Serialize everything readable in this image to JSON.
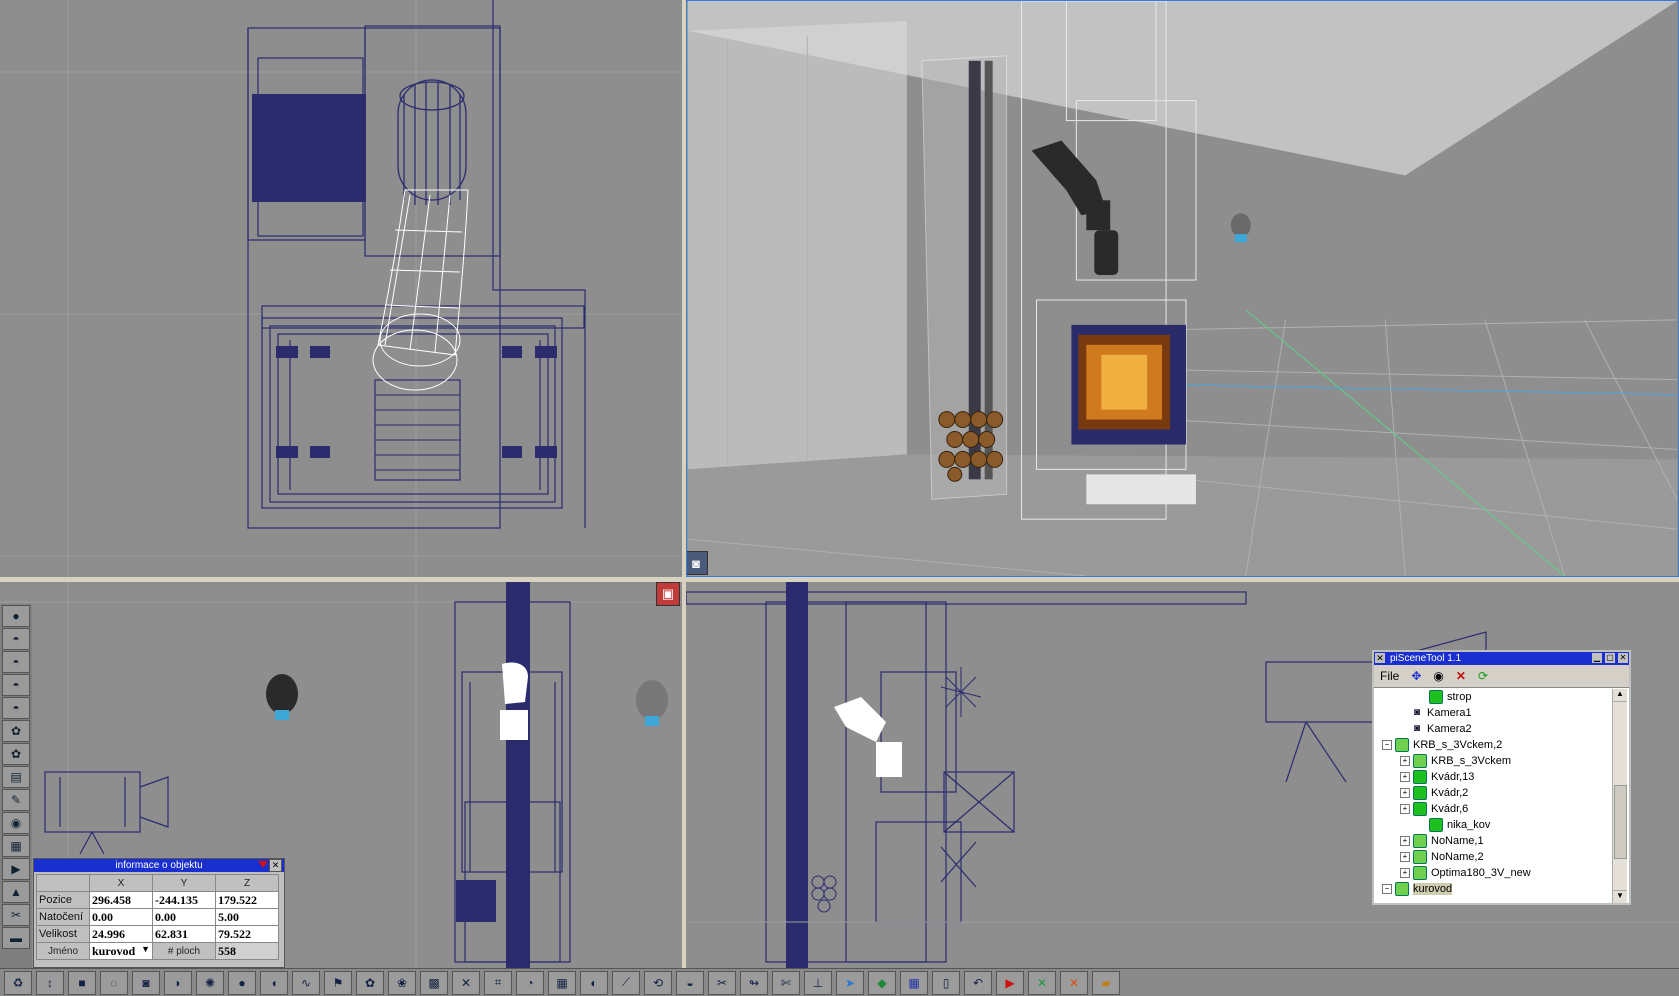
{
  "info_panel": {
    "title": "informace o objektu",
    "col_x": "X",
    "col_y": "Y",
    "col_z": "Z",
    "rows": [
      {
        "label": "Pozice",
        "x": "296.458",
        "y": "-244.135",
        "z": "179.522"
      },
      {
        "label": "Natočení",
        "x": "0.00",
        "y": "0.00",
        "z": "5.00"
      },
      {
        "label": "Velikost",
        "x": "24.996",
        "y": "62.831",
        "z": "79.522"
      }
    ],
    "name_label": "Jméno",
    "name_value": "kurovod",
    "faces_label": "# ploch",
    "faces_value": "558"
  },
  "scene_tool": {
    "title": "piSceneTool 1.1",
    "menu_file": "File",
    "nodes": [
      {
        "label": "strop",
        "depth": 2,
        "expander": "",
        "icon": "object-icon"
      },
      {
        "label": "Kamera1",
        "depth": 1,
        "expander": "",
        "icon": "camera-icon"
      },
      {
        "label": "Kamera2",
        "depth": 1,
        "expander": "",
        "icon": "camera-icon"
      },
      {
        "label": "KRB_s_3Vckem,2",
        "depth": 0,
        "expander": "−",
        "icon": "group-icon"
      },
      {
        "label": "KRB_s_3Vckem",
        "depth": 1,
        "expander": "+",
        "icon": "group-icon"
      },
      {
        "label": "Kvádr,13",
        "depth": 1,
        "expander": "+",
        "icon": "object-icon"
      },
      {
        "label": "Kvádr,2",
        "depth": 1,
        "expander": "+",
        "icon": "object-icon"
      },
      {
        "label": "Kvádr,6",
        "depth": 1,
        "expander": "+",
        "icon": "object-icon"
      },
      {
        "label": "nika_kov",
        "depth": 2,
        "expander": "",
        "icon": "object-icon"
      },
      {
        "label": "NoName,1",
        "depth": 1,
        "expander": "+",
        "icon": "group-icon"
      },
      {
        "label": "NoName,2",
        "depth": 1,
        "expander": "+",
        "icon": "group-icon"
      },
      {
        "label": "Optima180_3V_new",
        "depth": 1,
        "expander": "+",
        "icon": "group-icon"
      },
      {
        "label": "kurovod",
        "depth": 0,
        "expander": "−",
        "icon": "group-icon"
      }
    ]
  },
  "colors": {
    "wire": "#2b2c6e",
    "accent": "#1a2fcf",
    "viewport": "#8e8e8e"
  }
}
